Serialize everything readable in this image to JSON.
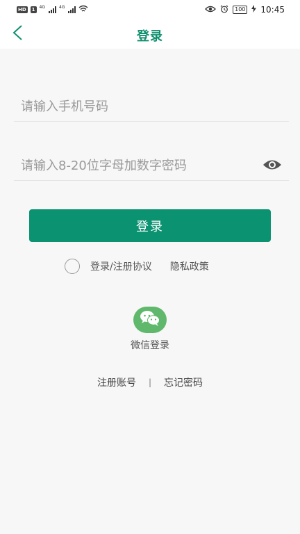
{
  "status_bar": {
    "hd_badge": "HD",
    "sim_badge": "1",
    "signal1_label": "4G",
    "signal2_label": "4G",
    "battery": "100",
    "time": "10:45"
  },
  "header": {
    "title": "登录",
    "back_icon": "chevron-left-icon"
  },
  "form": {
    "phone_placeholder": "请输入手机号码",
    "phone_value": "",
    "password_placeholder": "请输入8-20位字母加数字密码",
    "password_value": "",
    "eye_icon": "eye-icon"
  },
  "login_button_label": "登录",
  "agreement": {
    "checked": false,
    "terms_label": "登录/注册协议",
    "privacy_label": "隐私政策"
  },
  "wechat": {
    "icon": "wechat-icon",
    "label": "微信登录"
  },
  "links": {
    "register": "注册账号",
    "separator": "|",
    "forgot": "忘记密码"
  },
  "colors": {
    "accent": "#0a9271",
    "title": "#0e8f6e",
    "wechat": "#5fb86b",
    "background": "#f7f7f7"
  }
}
